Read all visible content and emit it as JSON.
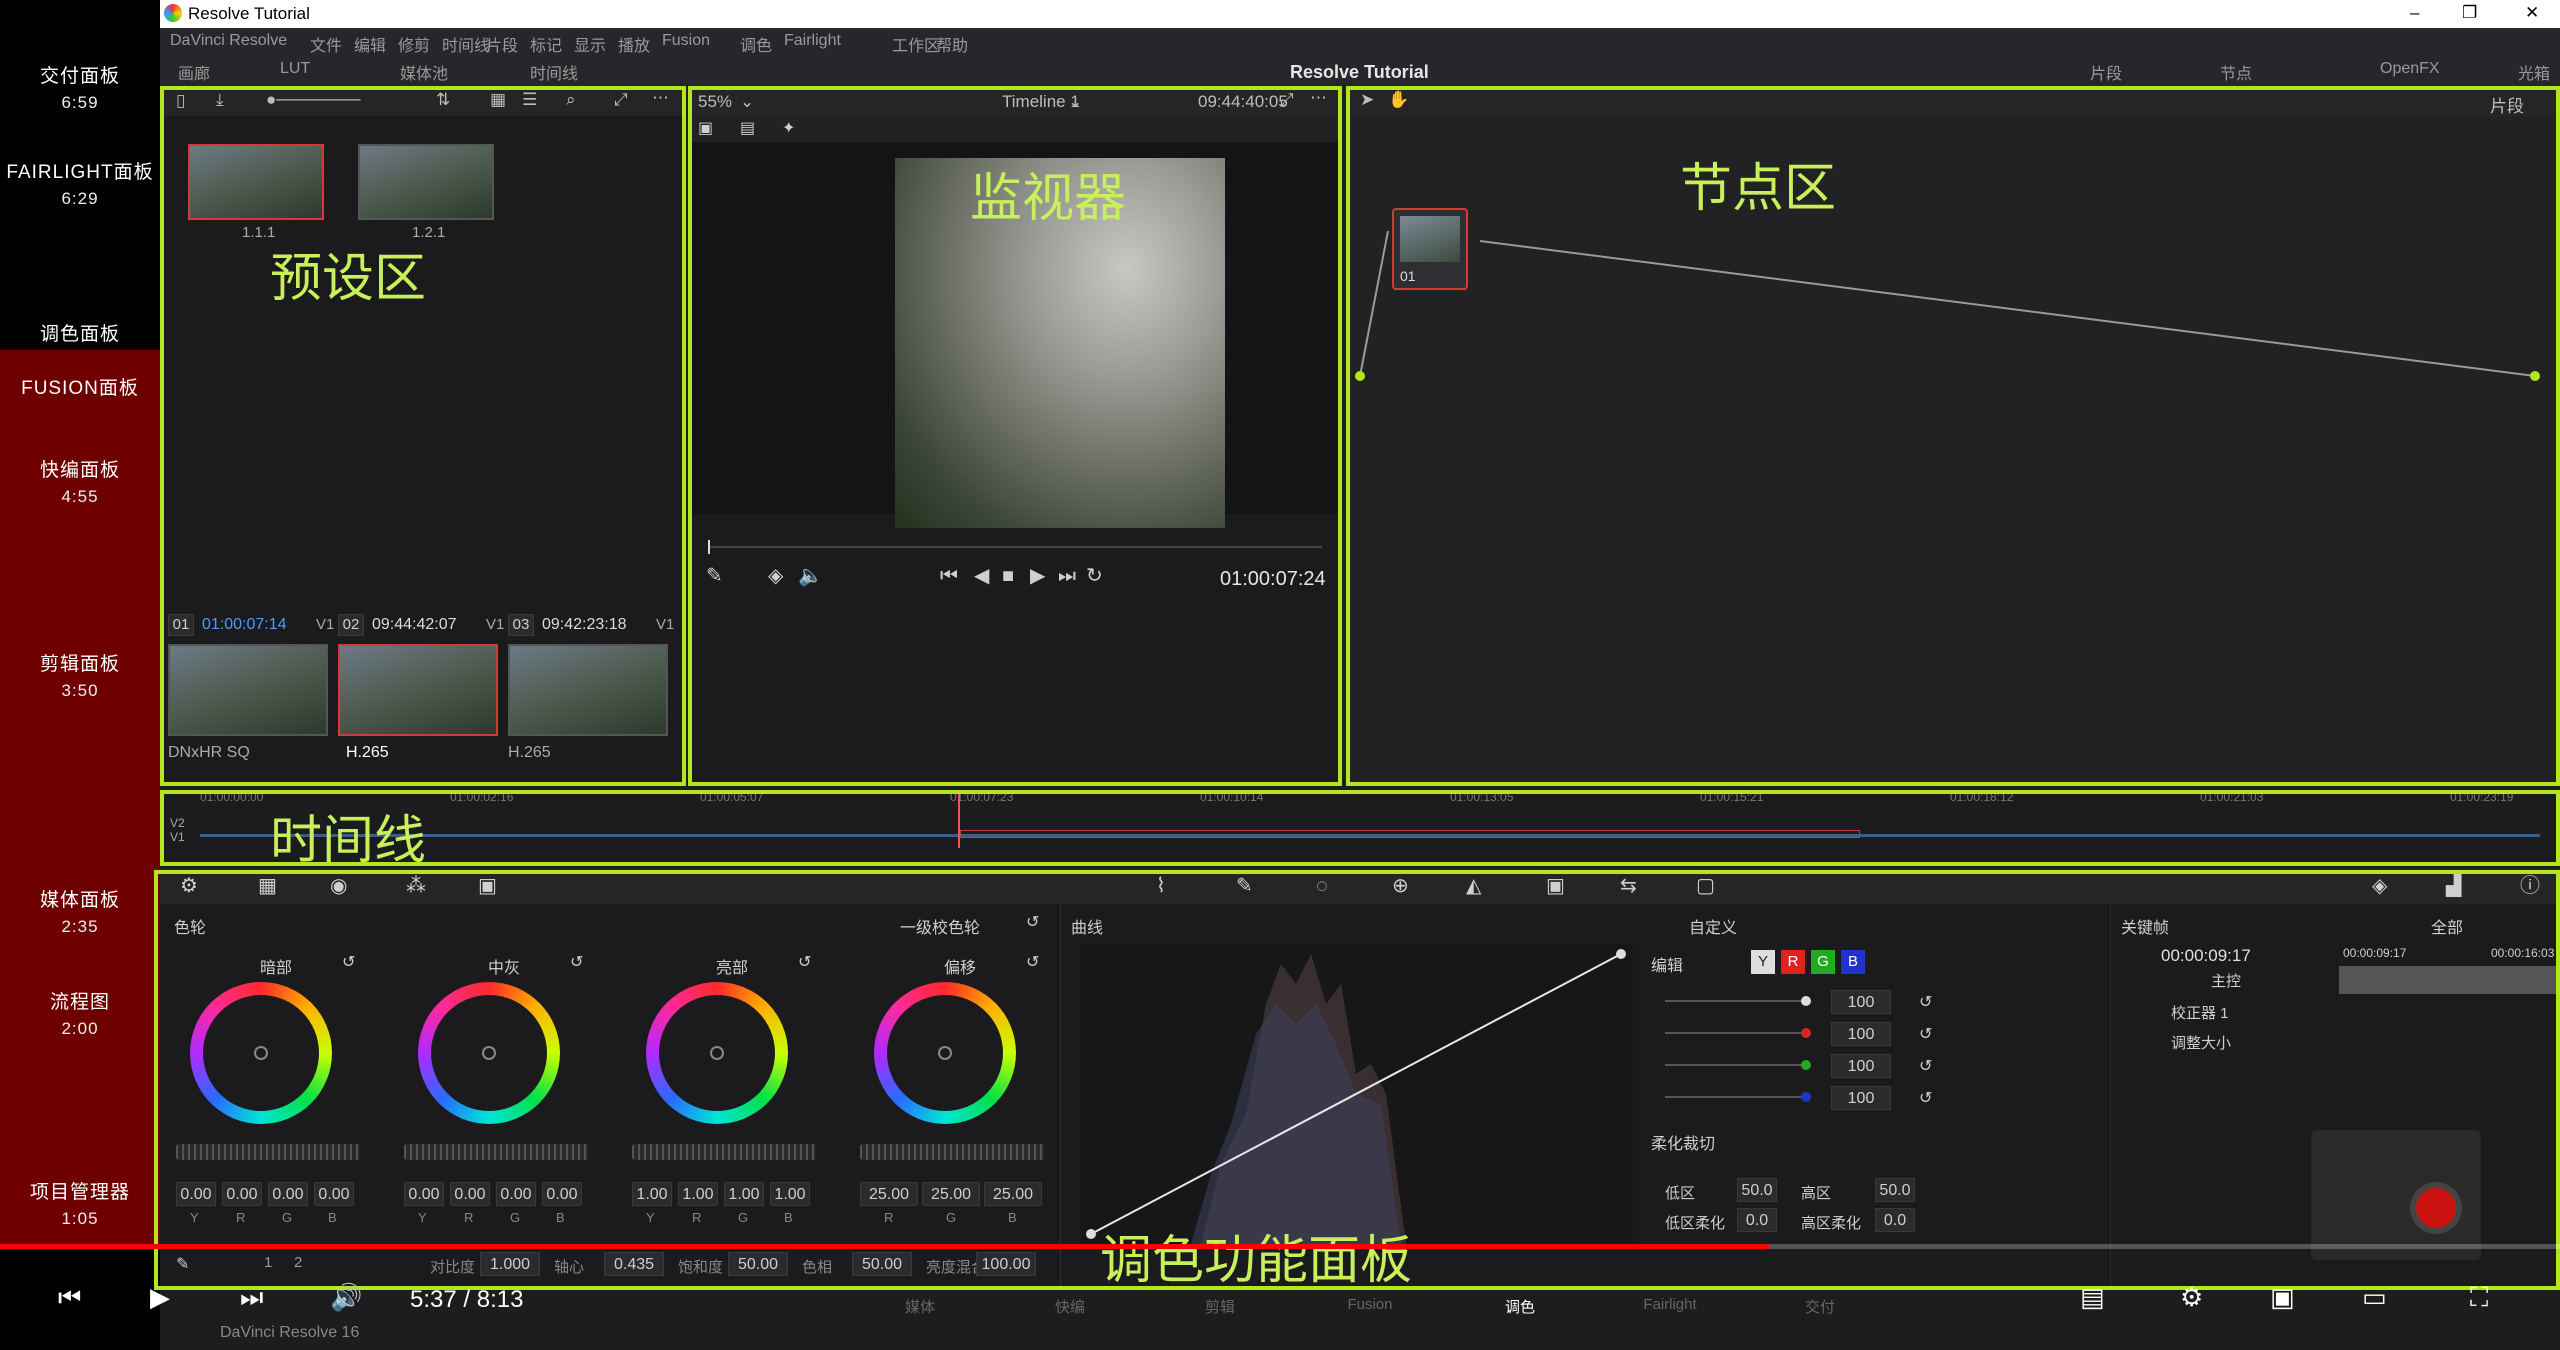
{
  "chapters": [
    {
      "name": "交付面板",
      "time": "6:59"
    },
    {
      "name": "FAIRLIGHT面板",
      "time": "6:29"
    },
    {
      "name": "调色面板",
      "time": ""
    },
    {
      "name": "FUSION面板",
      "time": ""
    },
    {
      "name": "快编面板",
      "time": "4:55"
    },
    {
      "name": "剪辑面板",
      "time": "3:50"
    },
    {
      "name": "媒体面板",
      "time": "2:35"
    },
    {
      "name": "流程图",
      "time": "2:00"
    },
    {
      "name": "项目管理器",
      "time": "1:05"
    }
  ],
  "window": {
    "title": "Resolve Tutorial",
    "minimize": "–",
    "restore": "❐",
    "close": "✕"
  },
  "menu": [
    "DaVinci Resolve",
    "文件",
    "编辑",
    "修剪",
    "时间线",
    "片段",
    "标记",
    "显示",
    "播放",
    "Fusion",
    "调色",
    "Fairlight",
    "工作区",
    "帮助"
  ],
  "toolbar": {
    "left": [
      "画廊",
      "LUT",
      "媒体池",
      "时间线"
    ],
    "center_title": "Resolve Tutorial",
    "right": [
      "片段",
      "节点",
      "OpenFX",
      "光箱"
    ]
  },
  "overlays": {
    "preset": "预设区",
    "monitor": "监视器",
    "nodes": "节点区",
    "timeline": "时间线",
    "color_panel": "调色功能面板"
  },
  "gallery": {
    "stills": [
      "1.1.1",
      "1.2.1"
    ]
  },
  "viewer": {
    "zoom": "55%",
    "timeline_name": "Timeline 1",
    "source_tc": "09:44:40:05",
    "current_tc": "01:00:07:24"
  },
  "clips": [
    {
      "num": "01",
      "tc": "01:00:07:14",
      "track": "V1",
      "codec": "DNxHR SQ"
    },
    {
      "num": "02",
      "tc": "09:44:42:07",
      "track": "V1",
      "codec": "H.265"
    },
    {
      "num": "03",
      "tc": "09:42:23:18",
      "track": "V1",
      "codec": "H.265"
    }
  ],
  "nodes": {
    "mode": "片段",
    "node_label": "01"
  },
  "mini_timeline": {
    "ticks": [
      "01:00:00:00",
      "01:00:02:16",
      "01:00:05:07",
      "01:00:07:23",
      "01:00:10:14",
      "01:00:13:05",
      "01:00:15:21",
      "01:00:18:12",
      "01:00:21:03",
      "01:00:23:19"
    ],
    "tracks": [
      "V2",
      "V1"
    ]
  },
  "color_wheels": {
    "title": "色轮",
    "mode": "一级校色轮",
    "wheels": [
      {
        "name": "暗部",
        "values": [
          "0.00",
          "0.00",
          "0.00",
          "0.00"
        ],
        "channels": [
          "Y",
          "R",
          "G",
          "B"
        ]
      },
      {
        "name": "中灰",
        "values": [
          "0.00",
          "0.00",
          "0.00",
          "0.00"
        ],
        "channels": [
          "Y",
          "R",
          "G",
          "B"
        ]
      },
      {
        "name": "亮部",
        "values": [
          "1.00",
          "1.00",
          "1.00",
          "1.00"
        ],
        "channels": [
          "Y",
          "R",
          "G",
          "B"
        ]
      },
      {
        "name": "偏移",
        "values": [
          "25.00",
          "25.00",
          "25.00"
        ],
        "channels": [
          "R",
          "G",
          "B"
        ]
      }
    ],
    "bottom": [
      {
        "label": "对比度",
        "value": "1.000"
      },
      {
        "label": "轴心",
        "value": "0.435"
      },
      {
        "label": "饱和度",
        "value": "50.00"
      },
      {
        "label": "色相",
        "value": "50.00"
      },
      {
        "label": "亮度混合",
        "value": "100.00"
      }
    ],
    "pages": [
      "1",
      "2"
    ]
  },
  "curves": {
    "title": "曲线",
    "mode": "自定义",
    "edit_label": "编辑",
    "channels": [
      "Y",
      "R",
      "G",
      "B"
    ],
    "intensity": [
      "100",
      "100",
      "100",
      "100"
    ],
    "soft_clip": "柔化裁切",
    "low": {
      "label": "低区",
      "value": "50.0"
    },
    "high": {
      "label": "高区",
      "value": "50.0"
    },
    "low_soft": {
      "label": "低区柔化",
      "value": "0.0"
    },
    "high_soft": {
      "label": "高区柔化",
      "value": "0.0"
    }
  },
  "keyframes": {
    "title": "关键帧",
    "filter": "全部",
    "tc": "00:00:09:17",
    "ruler": [
      "00:00:09:17",
      "00:00:16:03"
    ],
    "rows": [
      "主控",
      "校正器 1",
      "调整大小"
    ]
  },
  "pages_bar": [
    "媒体",
    "快编",
    "剪辑",
    "Fusion",
    "调色",
    "Fairlight",
    "交付"
  ],
  "app_version": "DaVinci Resolve 16",
  "player": {
    "time": "5:37 / 8:13",
    "progress": 0.691
  }
}
